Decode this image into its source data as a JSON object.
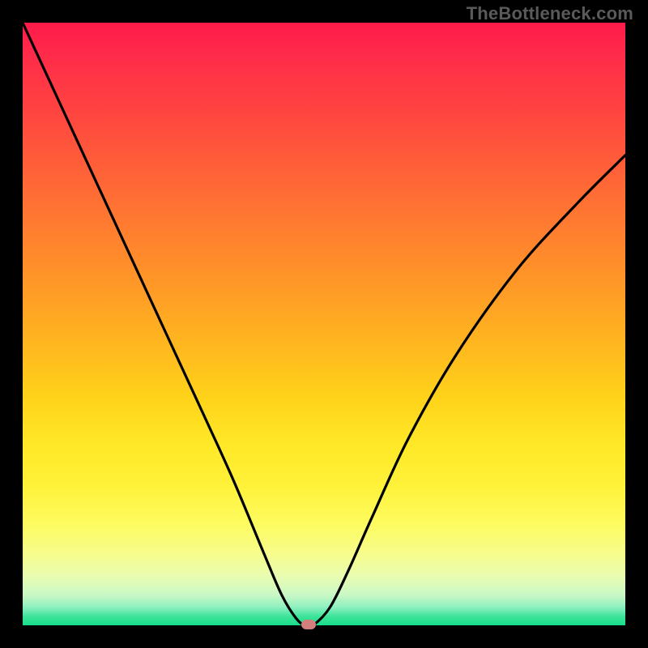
{
  "watermark": "TheBottleneck.com",
  "chart_data": {
    "type": "line",
    "title": "",
    "xlabel": "",
    "ylabel": "",
    "xlim": [
      0,
      1
    ],
    "ylim": [
      0,
      1
    ],
    "grid": false,
    "legend": false,
    "gradient": {
      "direction": "top-to-bottom",
      "stops": [
        {
          "pos": 0.0,
          "color": "#ff1a4a"
        },
        {
          "pos": 0.3,
          "color": "#ff7a30"
        },
        {
          "pos": 0.6,
          "color": "#ffd21a"
        },
        {
          "pos": 0.85,
          "color": "#fdfb5e"
        },
        {
          "pos": 1.0,
          "color": "#18dd8a"
        }
      ]
    },
    "series": [
      {
        "name": "bottleneck-curve",
        "color": "#000",
        "x": [
          0.0,
          0.06,
          0.12,
          0.18,
          0.24,
          0.3,
          0.35,
          0.4,
          0.43,
          0.455,
          0.47,
          0.482,
          0.51,
          0.54,
          0.58,
          0.64,
          0.72,
          0.82,
          0.92,
          1.0
        ],
        "y": [
          1.0,
          0.87,
          0.74,
          0.61,
          0.48,
          0.35,
          0.24,
          0.12,
          0.05,
          0.01,
          0.0,
          0.0,
          0.03,
          0.09,
          0.18,
          0.31,
          0.45,
          0.59,
          0.7,
          0.78
        ]
      }
    ],
    "marker": {
      "x": 0.475,
      "y": 0.002,
      "color": "#d37f7e"
    }
  }
}
